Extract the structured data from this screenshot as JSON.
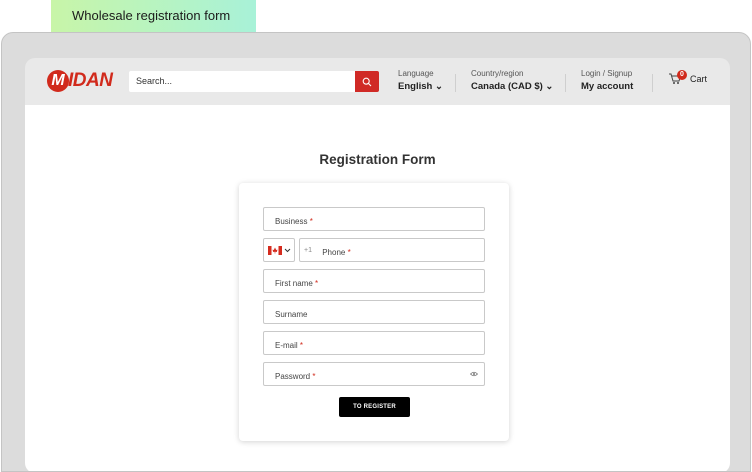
{
  "tag_label": "Wholesale registration form",
  "header": {
    "logo_letter": "M",
    "logo_text": "IDAN",
    "search_placeholder": "Search...",
    "language": {
      "label": "Language",
      "value": "English ⌄"
    },
    "country": {
      "label": "Country/region",
      "value": "Canada (CAD $) ⌄"
    },
    "account": {
      "label": "Login / Signup",
      "value": "My account"
    },
    "cart": {
      "count": "0",
      "label": "Cart"
    }
  },
  "form": {
    "title": "Registration Form",
    "business": "Business",
    "phone_code": "+1",
    "phone": "Phone",
    "first_name": "First name",
    "surname": "Surname",
    "email": "E-mail",
    "password": "Password",
    "required_mark": "*",
    "submit": "TO REGISTER"
  },
  "colors": {
    "brand": "#d12a1c",
    "button": "#000000"
  }
}
